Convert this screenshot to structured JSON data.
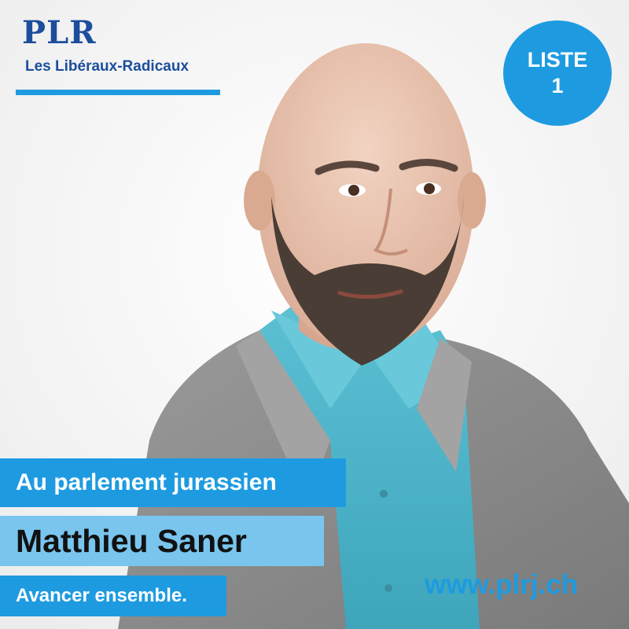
{
  "logo": {
    "mark": "PLR",
    "subtitle": "Les Libéraux-Radicaux"
  },
  "badge": {
    "line1": "LISTE",
    "line2": "1"
  },
  "bands": {
    "headline": "Au parlement jurassien",
    "candidate_name": "Matthieu Saner",
    "slogan": "Avancer ensemble."
  },
  "website": "www.plrj.ch",
  "colors": {
    "brand_blue": "#1e9be0",
    "logo_navy": "#1c4e9c",
    "light_blue_band": "#79c5ee",
    "shirt_turquoise": "#4fb5c9",
    "suit_grey": "#8c8c8c"
  },
  "photo": {
    "subject": "candidate-portrait"
  }
}
